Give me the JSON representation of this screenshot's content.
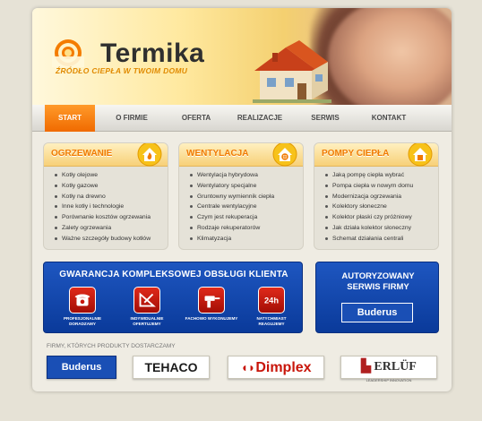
{
  "brand": {
    "name": "Termika",
    "tagline": "ŹRÓDŁO CIEPŁA W TWOIM DOMU"
  },
  "nav": [
    {
      "label": "START",
      "active": true
    },
    {
      "label": "O FIRMIE"
    },
    {
      "label": "OFERTA"
    },
    {
      "label": "REALIZACJE"
    },
    {
      "label": "SERWIS"
    },
    {
      "label": "KONTAKT"
    }
  ],
  "categories": [
    {
      "title": "OGRZEWANIE",
      "icon": "flame-house-icon",
      "items": [
        "Kotły olejowe",
        "Kotły gazowe",
        "Kotły na drewno",
        "Inne kotły i technologie",
        "Porównanie kosztów ogrzewania",
        "Zalety ogrzewania",
        "Ważne szczegóły budowy kotłów"
      ]
    },
    {
      "title": "WENTYLACJA",
      "icon": "fan-house-icon",
      "items": [
        "Wentylacja hybrydowa",
        "Wentylatory specjalne",
        "Gruntowny wymiennik ciepła",
        "Centrale wentylacyjne",
        "Czym jest rekuperacja",
        "Rodzaje rekuperatorów",
        "Klimatyzacja"
      ]
    },
    {
      "title": "POMPY CIEPŁA",
      "icon": "pump-house-icon",
      "items": [
        "Jaką pompę ciepła wybrać",
        "Pompa ciepła w nowym domu",
        "Modernizacja ogrzewania",
        "Kolektory słoneczne",
        "Kolektor płaski czy próżniowy",
        "Jak działa kolektor słoneczny",
        "Schemat działania centrali"
      ]
    }
  ],
  "guarantee": {
    "title": "GWARANCJA KOMPLEKSOWEJ OBSŁUGI KLIENTA",
    "items": [
      {
        "label": "PROFESJONALNIE DORADZAMY",
        "icon": "phone-icon"
      },
      {
        "label": "INDYWIDUALNIE OFERTUJEMY",
        "icon": "drafting-icon"
      },
      {
        "label": "FACHOWO WYKONUJEMY",
        "icon": "drill-icon"
      },
      {
        "label": "NATYCHMIAST REAGUJEMY",
        "icon": "24h-icon"
      }
    ]
  },
  "authorized": {
    "title": "AUTORYZOWANY SERWIS FIRMY",
    "brand": "Buderus"
  },
  "partners": {
    "title": "FIRMY, KTÓRYCH PRODUKTY DOSTARCZAMY",
    "items": [
      "Buderus",
      "TEHACO",
      "Dimplex",
      "ERLÜF"
    ],
    "erluf_sub": "LEADERSHIP INNOVATION"
  },
  "colors": {
    "accent": "#f07a00",
    "blue": "#0a3a9a",
    "red": "#c8150a"
  }
}
